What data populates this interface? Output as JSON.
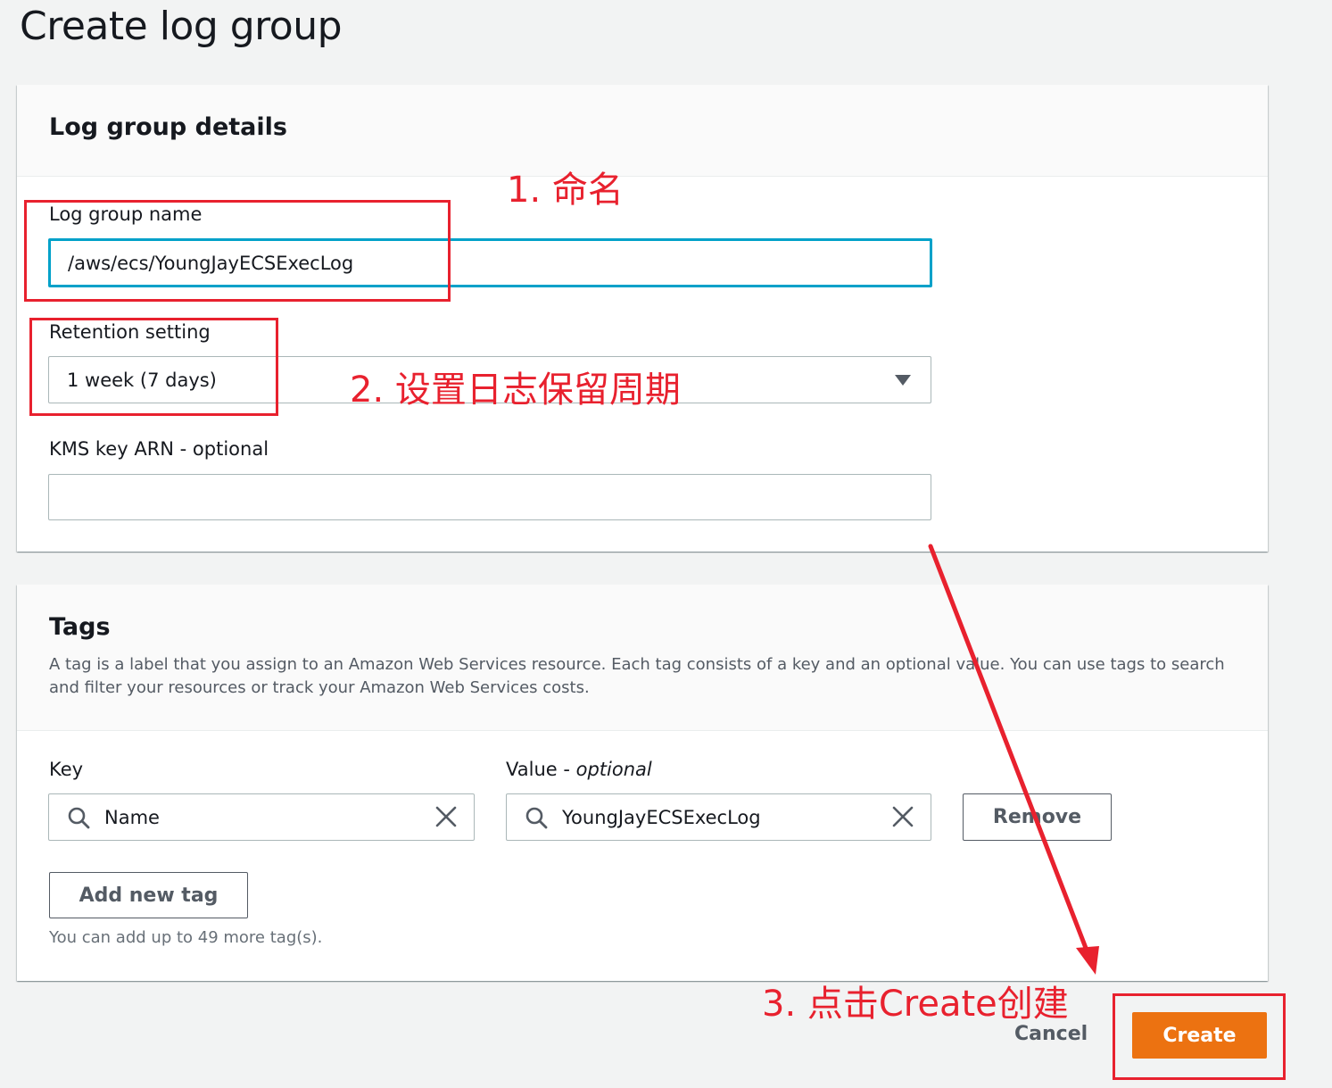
{
  "page": {
    "title": "Create log group"
  },
  "details": {
    "title": "Log group details",
    "log_group_name_label": "Log group name",
    "log_group_name_value": "/aws/ecs/YoungJayECSExecLog",
    "retention_label": "Retention setting",
    "retention_value": "1 week (7 days)",
    "kms_label": "KMS key ARN - optional",
    "kms_value": ""
  },
  "tags": {
    "title": "Tags",
    "description": "A tag is a label that you assign to an Amazon Web Services resource. Each tag consists of a key and an optional value. You can use tags to search and filter your resources or track your Amazon Web Services costs.",
    "key_label": "Key",
    "value_label_prefix": "Value - ",
    "value_label_optional": "optional",
    "rows": [
      {
        "key": "Name",
        "value": "YoungJayECSExecLog"
      }
    ],
    "remove_label": "Remove",
    "add_label": "Add new tag",
    "hint": "You can add up to 49 more tag(s)."
  },
  "footer": {
    "cancel_label": "Cancel",
    "create_label": "Create"
  },
  "annotations": {
    "step1": "1. 命名",
    "step2": "2. 设置日志保留周期",
    "step3": "3. 点击Create创建"
  },
  "colors": {
    "accent": "#00a1c9",
    "primary_button": "#ec7211",
    "annotation": "#e8212e"
  }
}
